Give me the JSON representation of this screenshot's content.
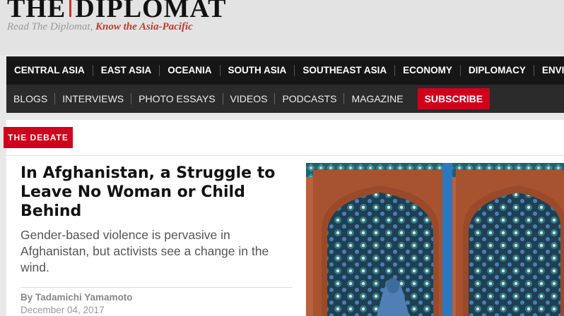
{
  "masthead": {
    "logo_left": "THE",
    "logo_right": "DIPLOMAT",
    "tagline_plain": "Read The Diplomat, ",
    "tagline_emph": "Know the Asia-Pacific"
  },
  "nav_primary": [
    "CENTRAL ASIA",
    "EAST ASIA",
    "OCEANIA",
    "SOUTH ASIA",
    "SOUTHEAST ASIA",
    "ECONOMY",
    "DIPLOMACY",
    "ENVI"
  ],
  "nav_secondary": [
    "BLOGS",
    "INTERVIEWS",
    "PHOTO ESSAYS",
    "VIDEOS",
    "PODCASTS",
    "MAGAZINE"
  ],
  "subscribe_label": "SUBSCRIBE",
  "section_label": "THE DEBATE",
  "article": {
    "title": "In Afghanistan, a Struggle to Leave No Woman or Child Behind",
    "summary": "Gender-based violence is pervasive in Afghanistan, but activists see a change in the wind.",
    "byline": "By Tadamichi Yamamoto",
    "date": "December 04, 2017"
  },
  "colors": {
    "accent": "#d0021b",
    "tagline_accent": "#c0392b",
    "nav_primary_bg": "#161616",
    "nav_secondary_bg": "#2b2b2b"
  }
}
